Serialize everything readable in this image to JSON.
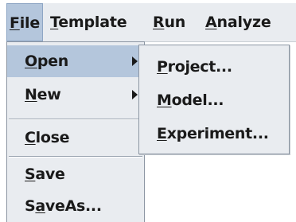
{
  "menubar": {
    "items": [
      {
        "mnemonic": "F",
        "rest": "ile"
      },
      {
        "mnemonic": "T",
        "rest": "emplate"
      },
      {
        "mnemonic": "R",
        "rest": "un"
      },
      {
        "mnemonic": "A",
        "rest": "nalyze"
      }
    ]
  },
  "file_menu": {
    "open": {
      "mnemonic": "O",
      "rest": "pen"
    },
    "new": {
      "mnemonic": "N",
      "rest": "ew"
    },
    "close": {
      "mnemonic": "C",
      "rest": "lose"
    },
    "save": {
      "mnemonic": "S",
      "rest": "ave"
    },
    "saveas": {
      "pre": "S",
      "mnemonic": "a",
      "rest": "veAs..."
    }
  },
  "open_submenu": {
    "project": {
      "mnemonic": "P",
      "rest": "roject..."
    },
    "model": {
      "mnemonic": "M",
      "rest": "odel..."
    },
    "experiment": {
      "mnemonic": "E",
      "rest": "xperiment..."
    }
  },
  "colors": {
    "menu_background": "#e9ecf0",
    "selection": "#b4c6dc"
  }
}
